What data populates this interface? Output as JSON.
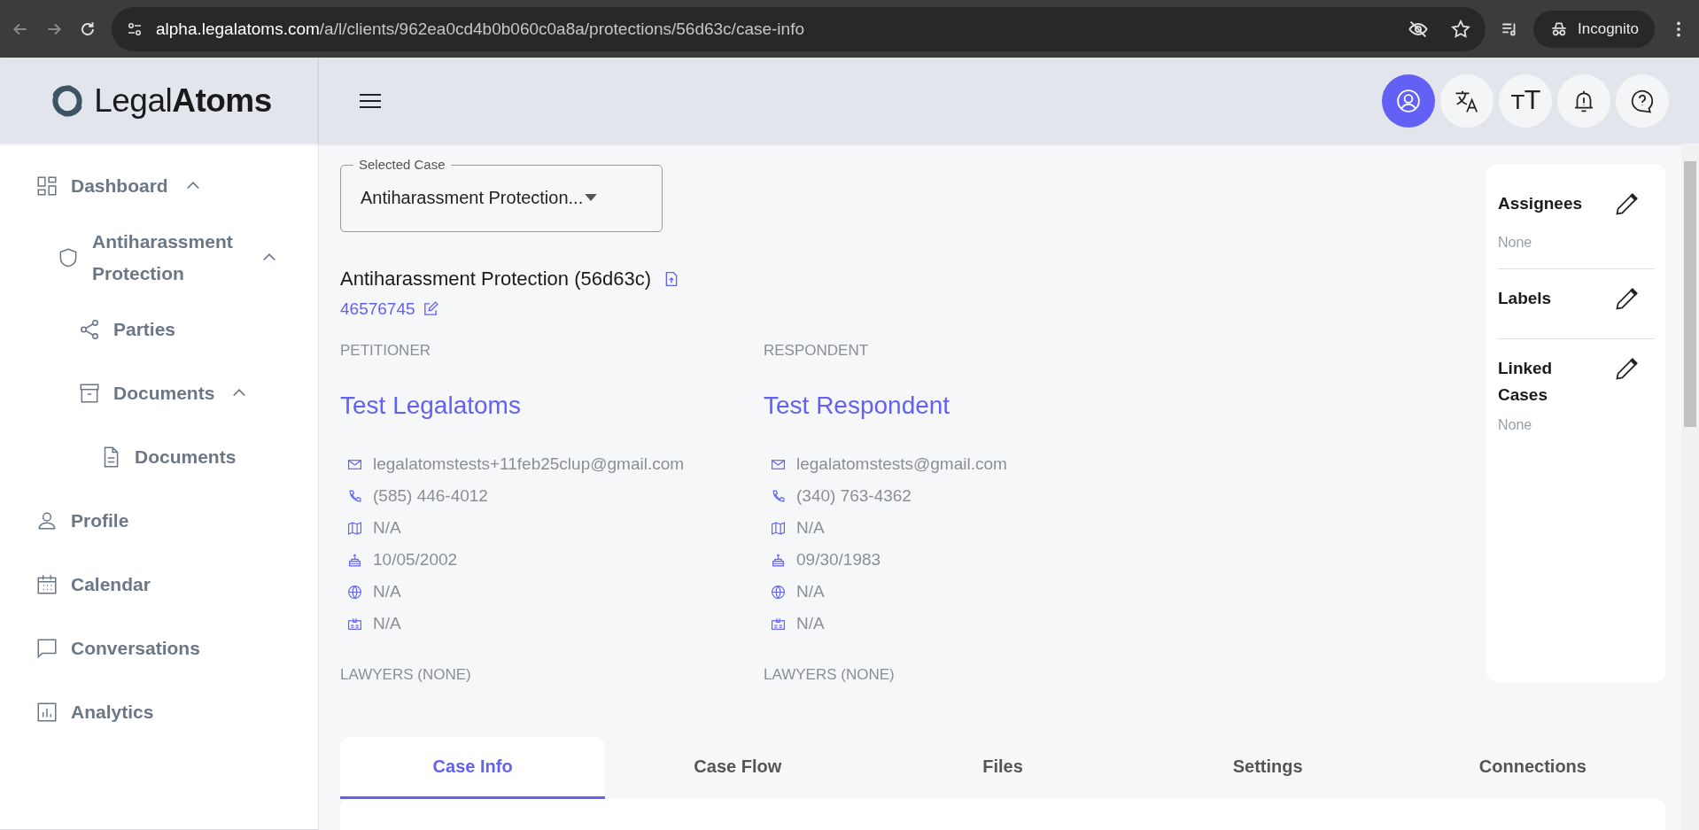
{
  "browser": {
    "url_host": "alpha.legalatoms.com",
    "url_path": "/a/l/clients/962ea0cd4b0b060c0a8a/protections/56d63c/case-info",
    "profile_label": "Incognito"
  },
  "sidebar": {
    "logo": "Legal**Atoms**",
    "items": [
      {
        "label": "Dashboard",
        "kind": "dashboard",
        "expanded": true,
        "children": [
          {
            "label": "Antiharassment Protection",
            "kind": "shield",
            "expanded": true,
            "children": [
              {
                "label": "Parties",
                "kind": "share"
              },
              {
                "label": "Documents",
                "kind": "archive",
                "expanded": true,
                "children": [
                  {
                    "label": "Documents",
                    "kind": "file"
                  }
                ]
              }
            ]
          }
        ]
      },
      {
        "label": "Profile",
        "kind": "user"
      },
      {
        "label": "Calendar",
        "kind": "calendar"
      },
      {
        "label": "Conversations",
        "kind": "chat"
      },
      {
        "label": "Analytics",
        "kind": "chart"
      }
    ]
  },
  "header_buttons": [
    {
      "kind": "profile",
      "selected": true
    },
    {
      "kind": "translate",
      "selected": false
    },
    {
      "kind": "text-size",
      "label": "ᴛT",
      "selected": false
    },
    {
      "kind": "alert",
      "selected": false
    },
    {
      "kind": "help",
      "selected": false
    }
  ],
  "selected_case": {
    "label": "Selected Case",
    "value": "Antiharassment Protection..."
  },
  "case_title": "Antiharassment Protection (56d63c)",
  "case_number": "46576745",
  "parties": [
    {
      "role": "PETITIONER",
      "name": "Test Legalatoms",
      "details": [
        {
          "kind": "email",
          "text": "legalatomstests+11feb25clup@gmail.com"
        },
        {
          "kind": "phone",
          "text": "(585) 446-4012"
        },
        {
          "kind": "map",
          "text": "N/A"
        },
        {
          "kind": "birthday",
          "text": "10/05/2002"
        },
        {
          "kind": "globe",
          "text": "N/A"
        },
        {
          "kind": "id",
          "text": "N/A"
        }
      ],
      "lawyers": "LAWYERS (NONE)"
    },
    {
      "role": "RESPONDENT",
      "name": "Test Respondent",
      "details": [
        {
          "kind": "email",
          "text": "legalatomstests@gmail.com"
        },
        {
          "kind": "phone",
          "text": "(340) 763-4362"
        },
        {
          "kind": "map",
          "text": "N/A"
        },
        {
          "kind": "birthday",
          "text": "09/30/1983"
        },
        {
          "kind": "globe",
          "text": "N/A"
        },
        {
          "kind": "id",
          "text": "N/A"
        }
      ],
      "lawyers": "LAWYERS (NONE)"
    }
  ],
  "side_panel": [
    {
      "title": "Assignees",
      "value": "None"
    },
    {
      "title": "Labels"
    },
    {
      "title": "Linked Cases",
      "value": "None"
    }
  ],
  "tabs": [
    {
      "label": "Case Info",
      "selected": true
    },
    {
      "label": "Case Flow",
      "selected": false
    },
    {
      "label": "Files",
      "selected": false
    },
    {
      "label": "Settings",
      "selected": false
    },
    {
      "label": "Connections",
      "selected": false
    }
  ]
}
